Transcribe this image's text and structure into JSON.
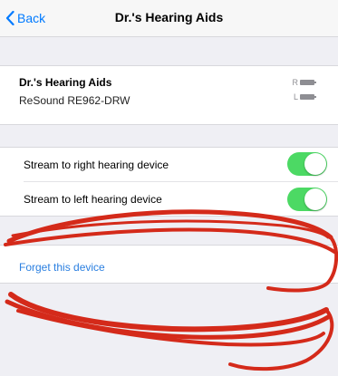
{
  "nav": {
    "back_label": "Back",
    "title": "Dr.'s Hearing Aids"
  },
  "device": {
    "name": "Dr.'s Hearing Aids",
    "model": "ReSound RE962-DRW",
    "battery_right_label": "R",
    "battery_left_label": "L"
  },
  "settings": {
    "rows": [
      {
        "label": "Stream to right hearing device",
        "enabled": true
      },
      {
        "label": "Stream to left hearing device",
        "enabled": true
      }
    ]
  },
  "actions": {
    "forget_label": "Forget this device"
  },
  "colors": {
    "accent": "#007aff",
    "toggle_on": "#4cd964",
    "annotation": "#d42a1a"
  },
  "icons": {
    "back": "chevron-left-icon",
    "battery": "battery-icon"
  }
}
